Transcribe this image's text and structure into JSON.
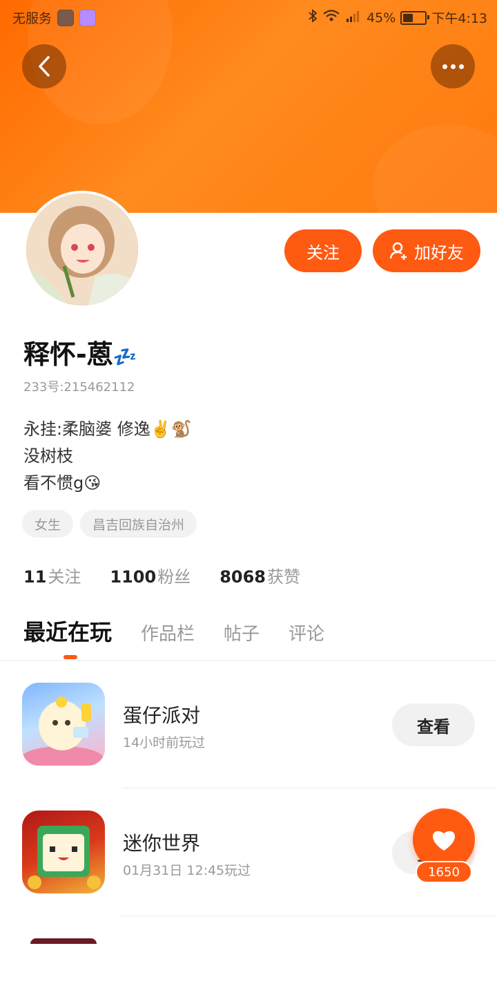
{
  "status_bar": {
    "carrier": "无服务",
    "battery_percent": "45%",
    "battery_level": 0.45,
    "time": "下午4:13"
  },
  "header": {
    "back_icon": "chevron-left-icon",
    "more_icon": "more-horizontal-icon"
  },
  "profile": {
    "follow_label": "关注",
    "add_friend_label": "加好友",
    "add_friend_icon": "add-person-icon",
    "name": "释怀-蒽",
    "name_badge": "💤",
    "id_text": "233号:215462112",
    "bio": [
      "永挂:柔脑婆 修逸✌️🐒",
      "没树枝",
      "看不惯g😘"
    ],
    "tags": [
      "女生",
      "昌吉回族自治州"
    ]
  },
  "stats": [
    {
      "value": "11",
      "label": "关注"
    },
    {
      "value": "1100",
      "label": "粉丝"
    },
    {
      "value": "8068",
      "label": "获赞"
    }
  ],
  "tabs": [
    "最近在玩",
    "作品栏",
    "帖子",
    "评论"
  ],
  "games": [
    {
      "name": "蛋仔派对",
      "sub": "14小时前玩过",
      "button": "查看"
    },
    {
      "name": "迷你世界",
      "sub": "01月31日 12:45玩过",
      "button": "查看"
    }
  ],
  "like": {
    "count": "1650",
    "icon": "heart-icon"
  },
  "colors": {
    "accent": "#ff5a12",
    "header_start": "#ff6a00",
    "header_end": "#ff8a1e"
  }
}
